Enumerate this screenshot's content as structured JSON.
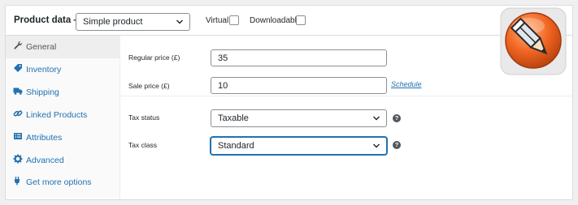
{
  "header": {
    "title": "Product data —",
    "product_type": "Simple product",
    "virtual_label": "Virtual:",
    "downloadable_label": "Downloadable:"
  },
  "sidebar": {
    "items": [
      {
        "label": "General",
        "icon": "wrench-icon",
        "active": true
      },
      {
        "label": "Inventory",
        "icon": "tag-icon"
      },
      {
        "label": "Shipping",
        "icon": "truck-icon"
      },
      {
        "label": "Linked Products",
        "icon": "link-icon"
      },
      {
        "label": "Attributes",
        "icon": "list-icon"
      },
      {
        "label": "Advanced",
        "icon": "gear-icon"
      },
      {
        "label": "Get more options",
        "icon": "plugin-icon"
      }
    ]
  },
  "general": {
    "regular_price": {
      "label": "Regular price (£)",
      "value": "35"
    },
    "sale_price": {
      "label": "Sale price (£)",
      "value": "10",
      "schedule_link": "Schedule"
    },
    "tax_status": {
      "label": "Tax status",
      "value": "Taxable"
    },
    "tax_class": {
      "label": "Tax class",
      "value": "Standard"
    }
  },
  "colors": {
    "accent": "#2271b1",
    "logo_orange": "#f26522",
    "panel_border": "#dcdcde"
  },
  "logo": {
    "icon": "pencil-icon"
  }
}
